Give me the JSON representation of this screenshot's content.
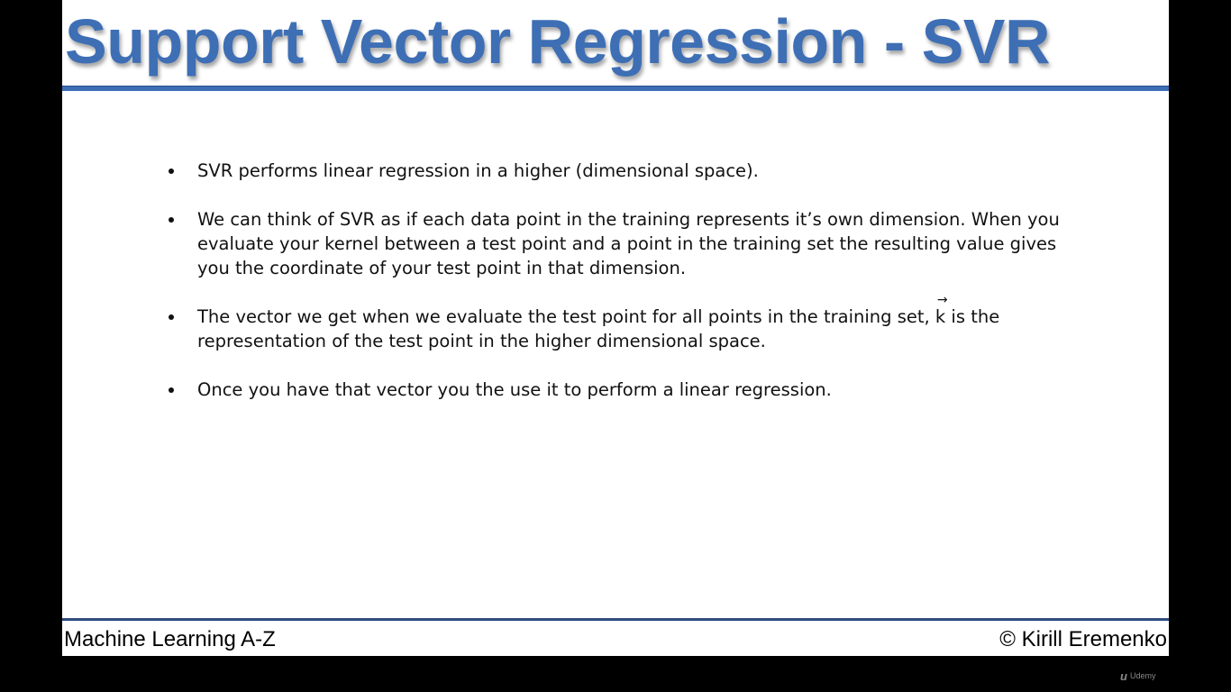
{
  "slide": {
    "title": "Support Vector Regression - SVR",
    "bullets": [
      {
        "text": "SVR performs linear regression in a higher (dimensional space)."
      },
      {
        "text": "We can think of SVR as if each data point in the training represents it’s own dimension. When you evaluate your kernel between a test point and a point in the training set the resulting value gives you the coordinate of your test point in that dimension."
      },
      {
        "text_before": "The vector we get when we evaluate the test point for all points in the training set, ",
        "vector_symbol": "k",
        "vector_arrow": "→",
        "text_after": " is the representation of the test point in the higher dimensional space."
      },
      {
        "text": "Once you have that vector you the use it to perform a linear regression."
      }
    ]
  },
  "footer": {
    "left": "Machine Learning A-Z",
    "right": "© Kirill Eremenko"
  },
  "watermark": {
    "logo": "u",
    "text": "Udemy"
  },
  "colors": {
    "title": "#3e6fb5",
    "title_rule": "#3e6fb5",
    "footer_rule": "#2f4d7f",
    "background": "#ffffff",
    "frame": "#000000"
  }
}
